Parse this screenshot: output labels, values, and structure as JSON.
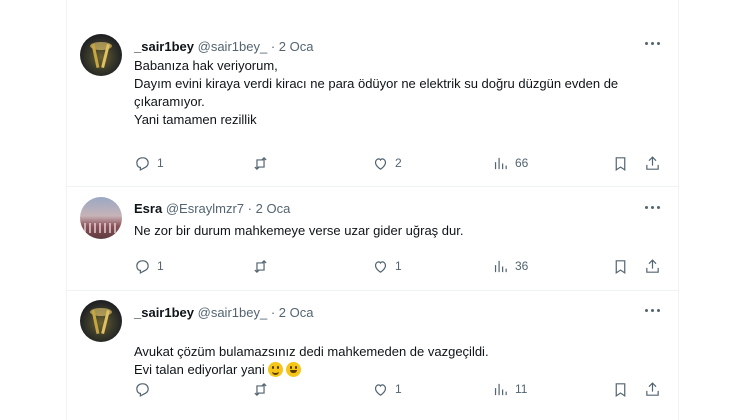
{
  "tweets": [
    {
      "name": "_sair1bey",
      "handle": "@sair1bey_",
      "sep": "·",
      "date": "2 Oca",
      "text": "Babanıza hak veriyorum,\nDayım evini kiraya verdi kiracı ne para ödüyor ne elektrik su doğru düzgün evden de çıkaramıyor.\n Yani tamamen rezillik",
      "reply_count": "1",
      "retweet_count": "",
      "like_count": "2",
      "view_count": "66"
    },
    {
      "name": "Esra",
      "handle": "@Esraylmzr7",
      "sep": "·",
      "date": "2 Oca",
      "text": "Ne zor bir durum mahkemeye verse uzar gider uğraş dur.",
      "reply_count": "1",
      "retweet_count": "",
      "like_count": "1",
      "view_count": "36"
    },
    {
      "name": "_sair1bey",
      "handle": "@sair1bey_",
      "sep": "·",
      "date": "2 Oca",
      "text": "Avukat çözüm bulamazsınız dedi mahkemeden de vazgeçildi.\nEvi talan ediyorlar yani",
      "emojis": [
        "slightly-smiling-face",
        "grinning-face"
      ],
      "reply_count": "",
      "retweet_count": "",
      "like_count": "1",
      "view_count": "11"
    }
  ],
  "icons": {
    "reply": "reply-icon",
    "retweet": "retweet-icon",
    "like": "heart-icon",
    "views": "views-icon",
    "bookmark": "bookmark-icon",
    "share": "share-icon",
    "more": "more-icon"
  },
  "colors": {
    "text": "#0f1419",
    "secondary": "#536471",
    "border": "#eff3f4"
  }
}
